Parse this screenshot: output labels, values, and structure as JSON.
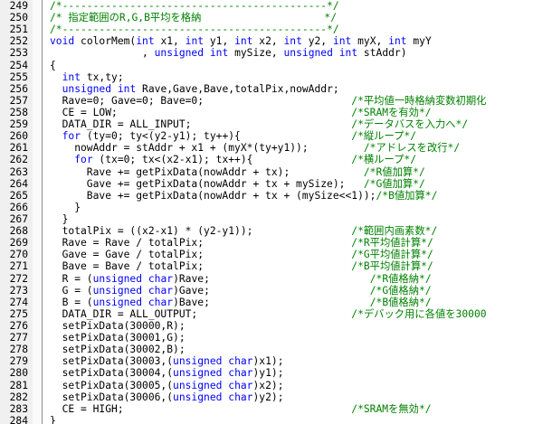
{
  "colors": {
    "keyword": "#0000ff",
    "comment": "#008000",
    "text": "#000000",
    "gutter_background": "#f0f0f0",
    "separator": "#8c8c8c"
  },
  "lines": [
    {
      "num": "249",
      "segs": [
        {
          "t": "/*-------------------------------------------*/",
          "c": "c"
        }
      ]
    },
    {
      "num": "250",
      "segs": [
        {
          "t": "/* 指定範囲のR,G,B平均を格納                    */",
          "c": "c"
        }
      ]
    },
    {
      "num": "251",
      "segs": [
        {
          "t": "/*-------------------------------------------*/",
          "c": "c"
        }
      ]
    },
    {
      "num": "252",
      "segs": [
        {
          "t": "void",
          "c": "k"
        },
        {
          "t": " colorMem(",
          "c": ""
        },
        {
          "t": "int",
          "c": "k"
        },
        {
          "t": " x1, ",
          "c": ""
        },
        {
          "t": "int",
          "c": "k"
        },
        {
          "t": " y1, ",
          "c": ""
        },
        {
          "t": "int",
          "c": "k"
        },
        {
          "t": " x2, ",
          "c": ""
        },
        {
          "t": "int",
          "c": "k"
        },
        {
          "t": " y2, ",
          "c": ""
        },
        {
          "t": "int",
          "c": "k"
        },
        {
          "t": " myX, ",
          "c": ""
        },
        {
          "t": "int",
          "c": "k"
        },
        {
          "t": " myY",
          "c": ""
        }
      ]
    },
    {
      "num": "253",
      "segs": [
        {
          "t": "               , ",
          "c": ""
        },
        {
          "t": "unsigned",
          "c": "k"
        },
        {
          "t": " ",
          "c": ""
        },
        {
          "t": "int",
          "c": "k"
        },
        {
          "t": " mySize, ",
          "c": ""
        },
        {
          "t": "unsigned",
          "c": "k"
        },
        {
          "t": " ",
          "c": ""
        },
        {
          "t": "int",
          "c": "k"
        },
        {
          "t": " stAddr)",
          "c": ""
        }
      ]
    },
    {
      "num": "254",
      "segs": [
        {
          "t": "{",
          "c": ""
        }
      ]
    },
    {
      "num": "255",
      "segs": [
        {
          "t": "  ",
          "c": ""
        },
        {
          "t": "int",
          "c": "k"
        },
        {
          "t": " tx,ty;",
          "c": ""
        }
      ]
    },
    {
      "num": "256",
      "segs": [
        {
          "t": "  ",
          "c": ""
        },
        {
          "t": "unsigned",
          "c": "k"
        },
        {
          "t": " ",
          "c": ""
        },
        {
          "t": "int",
          "c": "k"
        },
        {
          "t": " Rave,Gave,Bave,totalPix,nowAddr;",
          "c": ""
        }
      ]
    },
    {
      "num": "257",
      "segs": [
        {
          "t": "  Rave=0; Gave=0; Bave=0;                        ",
          "c": ""
        },
        {
          "t": "/*平均値一時格納変数初期化",
          "c": "c"
        }
      ]
    },
    {
      "num": "258",
      "segs": [
        {
          "t": "  CE = LOW;                                      ",
          "c": ""
        },
        {
          "t": "/*SRAMを有効*/",
          "c": "c"
        }
      ]
    },
    {
      "num": "259",
      "segs": [
        {
          "t": "  DATA_DIR = ALL_INPUT;                          ",
          "c": ""
        },
        {
          "t": "/*データバスを入力へ*/",
          "c": "c"
        }
      ]
    },
    {
      "num": "260",
      "segs": [
        {
          "t": "  ",
          "c": ""
        },
        {
          "t": "for",
          "c": "k"
        },
        {
          "t": " (ty=0; ty<(y2-y1); ty++){                  ",
          "c": ""
        },
        {
          "t": "/*縦ループ*/",
          "c": "c"
        }
      ]
    },
    {
      "num": "261",
      "segs": [
        {
          "t": "    nowAddr = stAddr + x1 + (myX*(ty+y1));         ",
          "c": ""
        },
        {
          "t": "/*アドレスを改行*/",
          "c": "c"
        }
      ]
    },
    {
      "num": "262",
      "segs": [
        {
          "t": "    ",
          "c": ""
        },
        {
          "t": "for",
          "c": "k"
        },
        {
          "t": " (tx=0; tx<(x2-x1); tx++){                ",
          "c": ""
        },
        {
          "t": "/*横ループ*/",
          "c": "c"
        }
      ]
    },
    {
      "num": "263",
      "segs": [
        {
          "t": "      Rave += getPixData(nowAddr + tx);            ",
          "c": ""
        },
        {
          "t": "/*R値加算*/",
          "c": "c"
        }
      ]
    },
    {
      "num": "264",
      "segs": [
        {
          "t": "      Gave += getPixData(nowAddr + tx + mySize);   ",
          "c": ""
        },
        {
          "t": "/*G値加算*/",
          "c": "c"
        }
      ]
    },
    {
      "num": "265",
      "segs": [
        {
          "t": "      Bave += getPixData(nowAddr + tx + (mySize<<1));",
          "c": ""
        },
        {
          "t": "/*B値加算*/",
          "c": "c"
        }
      ]
    },
    {
      "num": "266",
      "segs": [
        {
          "t": "    }",
          "c": ""
        }
      ]
    },
    {
      "num": "267",
      "segs": [
        {
          "t": "  }",
          "c": ""
        }
      ]
    },
    {
      "num": "268",
      "segs": [
        {
          "t": "  totalPix = ((x2-x1) * (y2-y1));                ",
          "c": ""
        },
        {
          "t": "/*範囲内画素数*/",
          "c": "c"
        }
      ]
    },
    {
      "num": "269",
      "segs": [
        {
          "t": "  Rave = Rave / totalPix;                        ",
          "c": ""
        },
        {
          "t": "/*R平均値計算*/",
          "c": "c"
        }
      ]
    },
    {
      "num": "270",
      "segs": [
        {
          "t": "  Gave = Gave / totalPix;                        ",
          "c": ""
        },
        {
          "t": "/*G平均値計算*/",
          "c": "c"
        }
      ]
    },
    {
      "num": "271",
      "segs": [
        {
          "t": "  Bave = Bave / totalPix;                        ",
          "c": ""
        },
        {
          "t": "/*B平均値計算*/",
          "c": "c"
        }
      ]
    },
    {
      "num": "272",
      "segs": [
        {
          "t": "  R = (",
          "c": ""
        },
        {
          "t": "unsigned",
          "c": "k"
        },
        {
          "t": " ",
          "c": ""
        },
        {
          "t": "char",
          "c": "k"
        },
        {
          "t": ")Rave;                          ",
          "c": ""
        },
        {
          "t": "/*R値格納*/",
          "c": "c"
        }
      ]
    },
    {
      "num": "273",
      "segs": [
        {
          "t": "  G = (",
          "c": ""
        },
        {
          "t": "unsigned",
          "c": "k"
        },
        {
          "t": " ",
          "c": ""
        },
        {
          "t": "char",
          "c": "k"
        },
        {
          "t": ")Gave;                          ",
          "c": ""
        },
        {
          "t": "/*G値格納*/",
          "c": "c"
        }
      ]
    },
    {
      "num": "274",
      "segs": [
        {
          "t": "  B = (",
          "c": ""
        },
        {
          "t": "unsigned",
          "c": "k"
        },
        {
          "t": " ",
          "c": ""
        },
        {
          "t": "char",
          "c": "k"
        },
        {
          "t": ")Bave;                          ",
          "c": ""
        },
        {
          "t": "/*B値格納*/",
          "c": "c"
        }
      ]
    },
    {
      "num": "275",
      "segs": [
        {
          "t": "  DATA_DIR = ALL_OUTPUT;                         ",
          "c": ""
        },
        {
          "t": "/*デバック用に各値を30000",
          "c": "c"
        }
      ]
    },
    {
      "num": "276",
      "segs": [
        {
          "t": "  setPixData(30000,R);",
          "c": ""
        }
      ]
    },
    {
      "num": "277",
      "segs": [
        {
          "t": "  setPixData(30001,G);",
          "c": ""
        }
      ]
    },
    {
      "num": "278",
      "segs": [
        {
          "t": "  setPixData(30002,B);",
          "c": ""
        }
      ]
    },
    {
      "num": "279",
      "segs": [
        {
          "t": "  setPixData(30003,(",
          "c": ""
        },
        {
          "t": "unsigned",
          "c": "k"
        },
        {
          "t": " ",
          "c": ""
        },
        {
          "t": "char",
          "c": "k"
        },
        {
          "t": ")x1);",
          "c": ""
        }
      ]
    },
    {
      "num": "280",
      "segs": [
        {
          "t": "  setPixData(30004,(",
          "c": ""
        },
        {
          "t": "unsigned",
          "c": "k"
        },
        {
          "t": " ",
          "c": ""
        },
        {
          "t": "char",
          "c": "k"
        },
        {
          "t": ")y1);",
          "c": ""
        }
      ]
    },
    {
      "num": "281",
      "segs": [
        {
          "t": "  setPixData(30005,(",
          "c": ""
        },
        {
          "t": "unsigned",
          "c": "k"
        },
        {
          "t": " ",
          "c": ""
        },
        {
          "t": "char",
          "c": "k"
        },
        {
          "t": ")x2);",
          "c": ""
        }
      ]
    },
    {
      "num": "282",
      "segs": [
        {
          "t": "  setPixData(30006,(",
          "c": ""
        },
        {
          "t": "unsigned",
          "c": "k"
        },
        {
          "t": " ",
          "c": ""
        },
        {
          "t": "char",
          "c": "k"
        },
        {
          "t": ")y2);",
          "c": ""
        }
      ]
    },
    {
      "num": "283",
      "segs": [
        {
          "t": "  CE = HIGH;                                     ",
          "c": ""
        },
        {
          "t": "/*SRAMを無効*/",
          "c": "c"
        }
      ]
    },
    {
      "num": "284",
      "segs": [
        {
          "t": "}",
          "c": ""
        }
      ]
    }
  ]
}
